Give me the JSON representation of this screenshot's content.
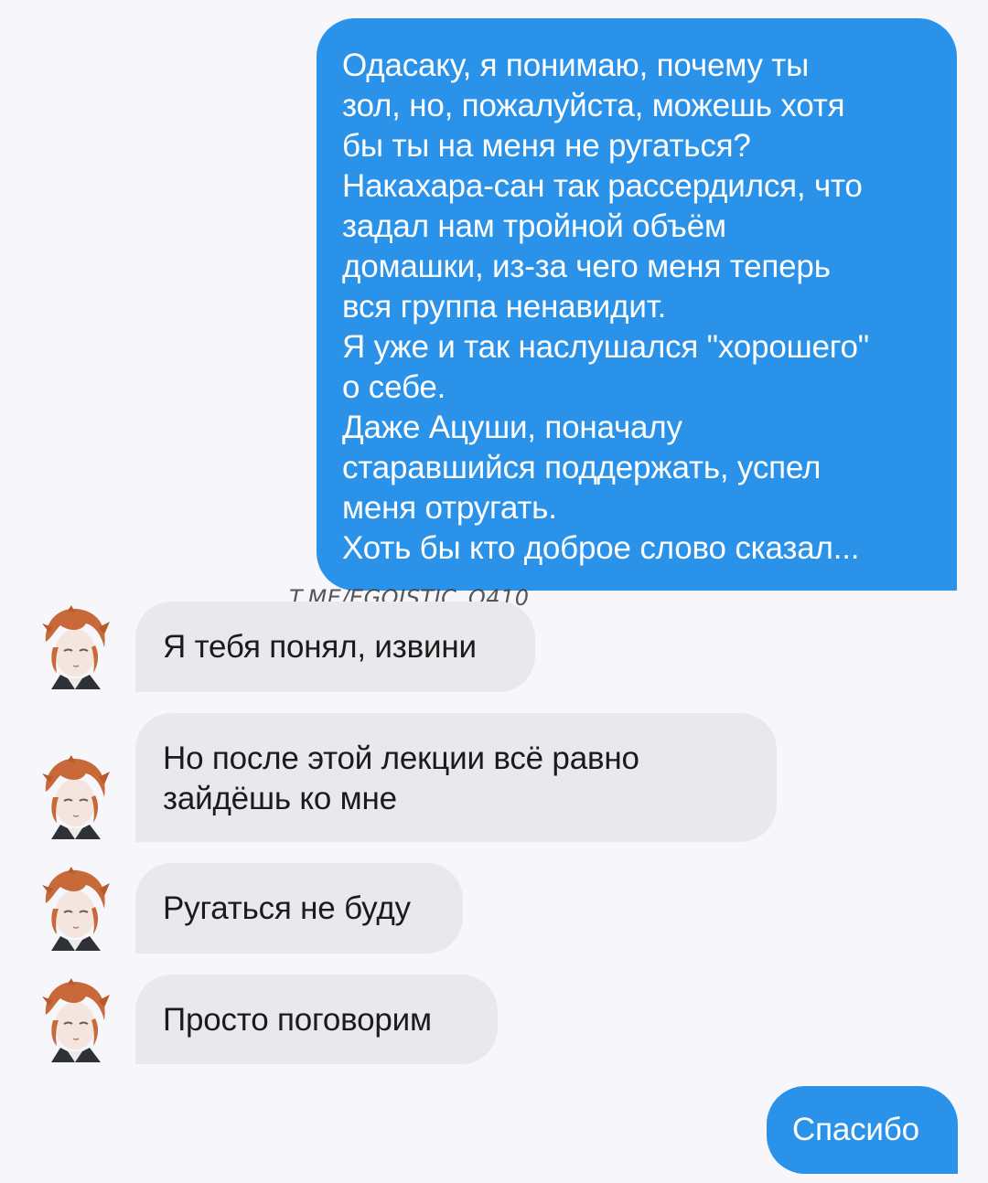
{
  "chat": {
    "outgoing_long": [
      "Одасаку, я понимаю, почему ты",
      "зол, но, пожалуйста, можешь хотя",
      "бы ты на меня не ругаться?",
      "Накахара-сан так рассердился, что",
      "задал нам тройной объём",
      "домашки, из-за чего меня теперь",
      "вся группа ненавидит.",
      "Я уже и так наслушался \"хорошего\"",
      "о себе.",
      "Даже Ацуши, поначалу",
      "старавшийся поддержать, успел",
      "меня отругать.",
      "Хоть бы кто доброе слово сказал..."
    ],
    "watermark": "T.ME/EGOISTIC_O410",
    "incoming": [
      {
        "lines": [
          "Я тебя понял, извини"
        ]
      },
      {
        "lines": [
          "Но после этой лекции всё равно",
          "зайдёшь ко мне"
        ]
      },
      {
        "lines": [
          "Ругаться не буду"
        ]
      },
      {
        "lines": [
          "Просто поговорим"
        ]
      }
    ],
    "outgoing_last": [
      "Спасибо"
    ]
  },
  "colors": {
    "background": "#f7f6fa",
    "outgoing_bubble": "#2a93e9",
    "incoming_bubble": "#e8e8ed"
  }
}
